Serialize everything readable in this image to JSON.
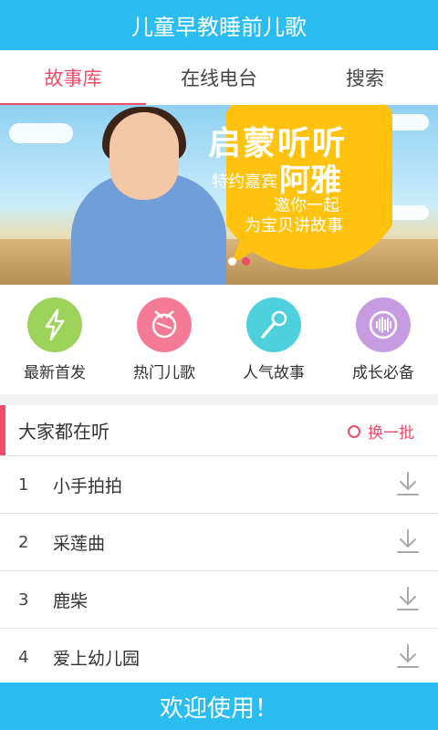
{
  "app": {
    "title": "儿童早教睡前儿歌"
  },
  "tabs": [
    {
      "label": "故事库",
      "active": true
    },
    {
      "label": "在线电台",
      "active": false
    },
    {
      "label": "搜索",
      "active": false
    }
  ],
  "banner": {
    "headline": "启蒙听听",
    "guest_label": "特约嘉宾",
    "guest_name": "阿雅",
    "line1": "邀你一起",
    "line2": "为宝贝讲故事",
    "slide_index": 2,
    "slide_count": 2
  },
  "categories": [
    {
      "label": "最新首发",
      "icon": "lightning-icon",
      "color": "#9dd35a"
    },
    {
      "label": "热门儿歌",
      "icon": "drum-icon",
      "color": "#f47a96"
    },
    {
      "label": "人气故事",
      "icon": "microphone-icon",
      "color": "#4fd1dd"
    },
    {
      "label": "成长必备",
      "icon": "soundwave-icon",
      "color": "#c79be2"
    }
  ],
  "listen_section": {
    "title": "大家都在听",
    "refresh_label": "换一批",
    "items": [
      {
        "num": "1",
        "name": "小手拍拍"
      },
      {
        "num": "2",
        "name": "采莲曲"
      },
      {
        "num": "3",
        "name": "鹿柴"
      },
      {
        "num": "4",
        "name": "爱上幼儿园"
      }
    ]
  },
  "footer": {
    "text": "欢迎使用！"
  },
  "colors": {
    "primary": "#2bbcf2",
    "accent": "#f04d6a"
  }
}
